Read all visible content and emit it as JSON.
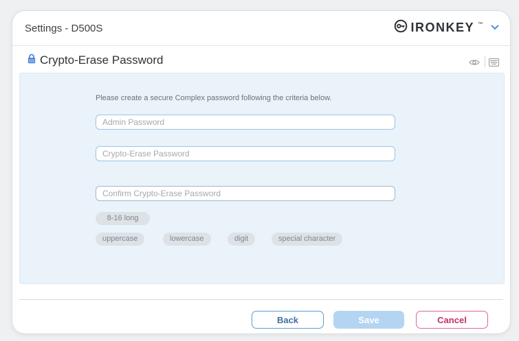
{
  "window": {
    "title": "Settings - D500S"
  },
  "brand": {
    "name": "IRONKEY",
    "trademark": "™",
    "logo_icon": "ironkey-key-icon",
    "menu_icon": "chevron-down-icon"
  },
  "section": {
    "title": "Crypto-Erase Password",
    "icon": "lock-icon",
    "right_icons": [
      "eye-icon",
      "keyboard-icon"
    ]
  },
  "form": {
    "instructions": "Please create a secure Complex password following the criteria below.",
    "admin_password": {
      "placeholder": "Admin Password",
      "value": ""
    },
    "crypto_erase_password": {
      "placeholder": "Crypto-Erase Password",
      "value": ""
    },
    "confirm_password": {
      "placeholder": "Confirm Crypto-Erase Password",
      "value": ""
    }
  },
  "criteria": {
    "length": "8-16 long",
    "items": [
      "uppercase",
      "lowercase",
      "digit",
      "special character"
    ]
  },
  "buttons": {
    "back": "Back",
    "save": "Save",
    "cancel": "Cancel"
  },
  "colors": {
    "accent_blue": "#5b9bd5",
    "save_disabled": "#b4d5f1",
    "cancel_pink": "#e0629a",
    "panel_bg": "#eaf2fa",
    "lock_blue": "#4a86d8"
  }
}
